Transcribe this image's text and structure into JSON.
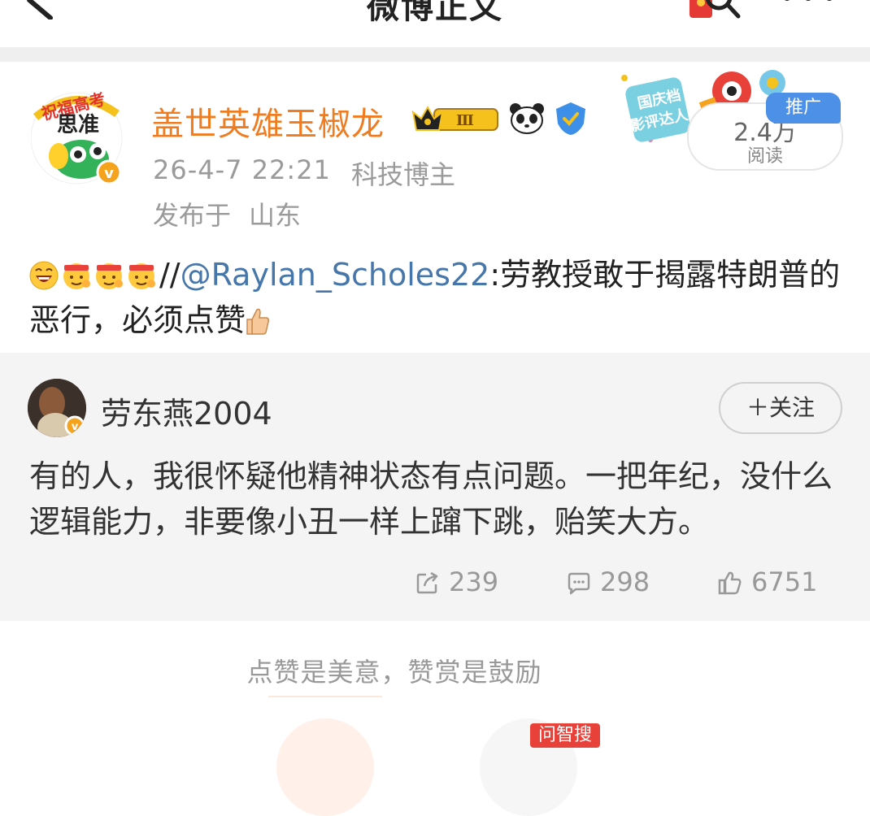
{
  "nav": {
    "title": "微博正文"
  },
  "post": {
    "author_name": "盖世英雄玉椒龙",
    "badge_level": "Ⅲ",
    "timestamp": "26-4-7 22:21",
    "author_tag": "科技博主",
    "location_label": "发布于",
    "location": "山东",
    "reads_count": "2.4万",
    "reads_label": "阅读",
    "promo_tag": "推广",
    "festival_badge_text": [
      "国庆档",
      "影评达人"
    ],
    "avatar_text": "祝福高考 思准",
    "body_prefix": "//",
    "mention": "@Raylan_Scholes22",
    "body_text": ":劳教授敢于揭露特朗普的恶行，必须点赞"
  },
  "repost": {
    "author": "劳东燕2004",
    "follow_label": "＋关注",
    "text": "有的人，我很怀疑他精神状态有点问题。一把年纪，没什么逻辑能力，非要像小丑一样上蹿下跳，贻笑大方。",
    "reposts": "239",
    "comments": "298",
    "likes": "6751"
  },
  "reward": {
    "label": "点赞是美意，赞赏是鼓励",
    "ask_tag": "问智搜"
  },
  "colors": {
    "author_name": "#f07c21",
    "mention": "#4777aa",
    "promo": "#4d90e8",
    "repost_bg": "#f4f4f4"
  }
}
